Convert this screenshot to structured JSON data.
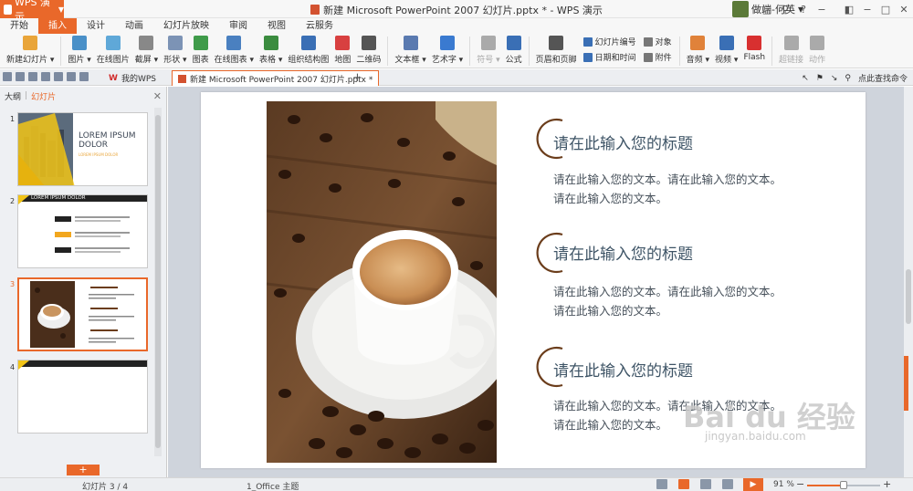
{
  "titlebar": {
    "app_name": "WPS 演示",
    "doc_title": "新建 Microsoft PowerPoint 2007 幻灯片.pptx * - WPS 演示",
    "user_name": "做端-何英",
    "controls": [
      "□",
      "⚲",
      "?",
      "−",
      "◧",
      "−",
      "□",
      "✕"
    ]
  },
  "menu_tabs": [
    {
      "label": "开始",
      "active": false
    },
    {
      "label": "插入",
      "active": true
    },
    {
      "label": "设计",
      "active": false
    },
    {
      "label": "动画",
      "active": false
    },
    {
      "label": "幻灯片放映",
      "active": false
    },
    {
      "label": "审阅",
      "active": false
    },
    {
      "label": "视图",
      "active": false
    },
    {
      "label": "云服务",
      "active": false
    }
  ],
  "ribbon": {
    "buttons": [
      {
        "label": "新建幻灯片 ▾",
        "color": "#e9a53a"
      },
      {
        "label": "图片 ▾",
        "color": "#4a90c8"
      },
      {
        "label": "在线图片",
        "color": "#5fa8d8"
      },
      {
        "label": "截屏 ▾",
        "color": "#888888"
      },
      {
        "label": "形状 ▾",
        "color": "#7c93b5"
      },
      {
        "label": "图表",
        "color": "#3f9b4a"
      },
      {
        "label": "在线图表 ▾",
        "color": "#4a80c0"
      },
      {
        "label": "表格 ▾",
        "color": "#3b8c3f"
      },
      {
        "label": "组织结构图",
        "color": "#3a6fb5"
      },
      {
        "label": "地图",
        "color": "#d84040"
      },
      {
        "label": "二维码",
        "color": "#555555"
      },
      {
        "label": "文本框 ▾",
        "color": "#5a7ab0"
      },
      {
        "label": "艺术字 ▾",
        "color": "#3a7ad0"
      },
      {
        "label": "符号 ▾",
        "color": "#aaaaaa"
      },
      {
        "label": "公式",
        "color": "#3a6fb5"
      },
      {
        "label": "页眉和页脚",
        "color": "#555555"
      }
    ],
    "small_buttons": [
      {
        "label": "幻灯片编号",
        "color": "#3a6fb5"
      },
      {
        "label": "对象",
        "color": "#777777"
      },
      {
        "label": "日期和时间",
        "color": "#3a6fb5"
      },
      {
        "label": "附件",
        "color": "#777777"
      }
    ],
    "media_buttons": [
      {
        "label": "音频 ▾",
        "color": "#e0823a"
      },
      {
        "label": "视频 ▾",
        "color": "#3a6fb5"
      },
      {
        "label": "Flash",
        "color": "#d83030"
      },
      {
        "label": "超链接",
        "color": "#aaaaaa"
      },
      {
        "label": "动作",
        "color": "#aaaaaa"
      }
    ]
  },
  "tabstrip": {
    "home_tab": "我的WPS",
    "doc_tab": "新建 Microsoft PowerPoint 2007 幻灯片.pptx *",
    "right_text": "点此查找命令"
  },
  "left_panel": {
    "tabs": [
      "大纲",
      "幻灯片"
    ],
    "active_tab": "幻灯片",
    "slides": [
      {
        "num": "1",
        "title": "LOREM IPSUM DOLOR",
        "sub": "LOREM IPSUM DOLOR"
      },
      {
        "num": "2",
        "title": "LOREM IPSUM DOLOR"
      },
      {
        "num": "3"
      },
      {
        "num": "4"
      }
    ],
    "add_label": "+"
  },
  "slide": {
    "sections": [
      {
        "title": "请在此输入您的标题",
        "body_line1": "请在此输入您的文本。请在此输入您的文本。",
        "body_line2": "请在此输入您的文本。"
      },
      {
        "title": "请在此输入您的标题",
        "body_line1": "请在此输入您的文本。请在此输入您的文本。",
        "body_line2": "请在此输入您的文本。"
      },
      {
        "title": "请在此输入您的标题",
        "body_line1": "请在此输入您的文本。请在此输入您的文本。",
        "body_line2": "请在此输入您的文本。"
      }
    ],
    "accent_color": "#6b3d1b"
  },
  "watermark": {
    "main": "Bai du 经验",
    "sub": "jingyan.baidu.com"
  },
  "statusbar": {
    "slide_info": "幻灯片 3 / 4",
    "theme": "1_Office 主题",
    "zoom": "91 %",
    "zoom_level": 0.5,
    "minus": "−",
    "plus": "+"
  }
}
